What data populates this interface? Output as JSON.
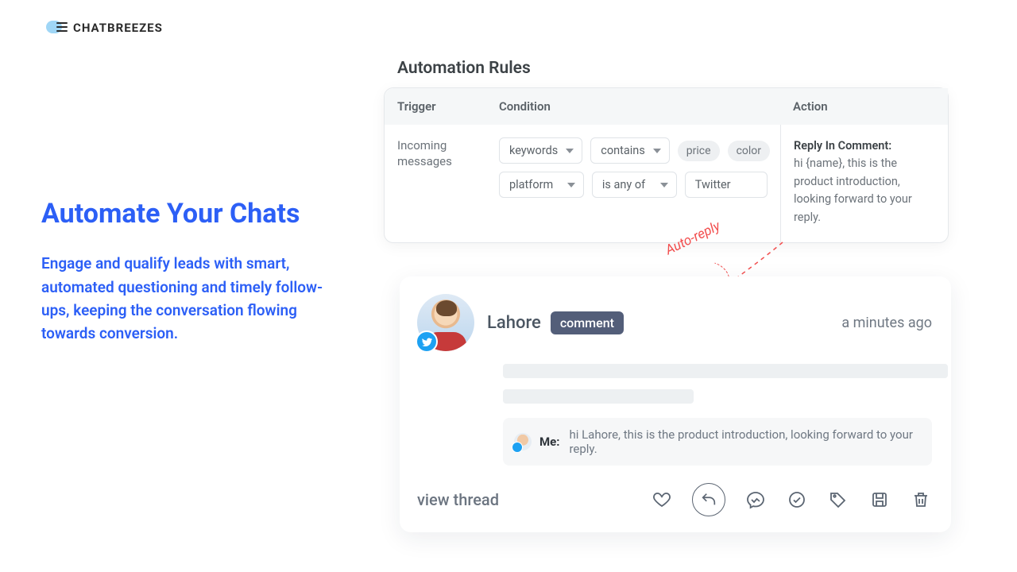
{
  "brand": {
    "name": "CHATBREEZES"
  },
  "hero": {
    "title": "Automate Your Chats",
    "body": "Engage and qualify leads with smart, automated questioning and timely follow-ups, keeping the conversation flowing towards conversion."
  },
  "rules": {
    "title": "Automation Rules",
    "headers": {
      "trigger": "Trigger",
      "condition": "Condition",
      "action": "Action"
    },
    "trigger": "Incoming messages",
    "condition": {
      "row1": {
        "field": "keywords",
        "op": "contains",
        "chips": [
          "price",
          "color"
        ]
      },
      "row2": {
        "field": "platform",
        "op": "is any of",
        "value": "Twitter"
      }
    },
    "action": {
      "label": "Reply In Comment:",
      "text": "hi {name}, this is the product introduction, looking forward to your reply."
    }
  },
  "annotation": {
    "label": "Auto-reply"
  },
  "comment": {
    "username": "Lahore",
    "badge": "comment",
    "time": "a minutes ago",
    "reply": {
      "author": "Me:",
      "text": "hi Lahore, this is the product introduction, looking forward to your reply."
    },
    "viewThread": "view thread"
  },
  "icons": {
    "heart": "heart-icon",
    "reply": "reply-icon",
    "messenger": "messenger-icon",
    "check": "check-icon",
    "tag": "tag-icon",
    "save": "save-icon",
    "trash": "trash-icon",
    "twitter": "twitter-icon"
  }
}
